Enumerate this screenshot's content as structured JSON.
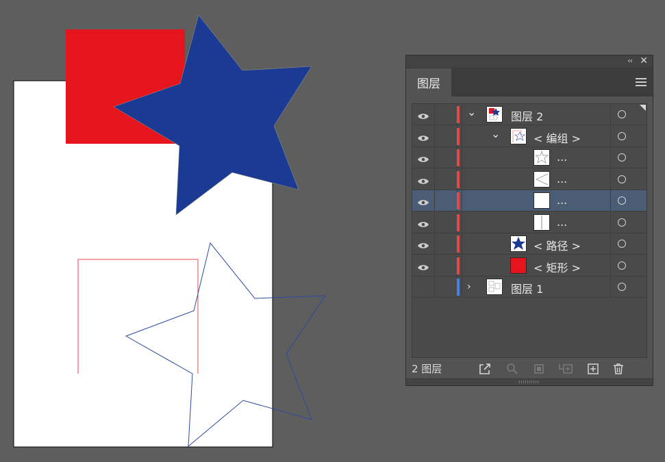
{
  "colors": {
    "canvas_bg": "#5e5e5e",
    "artboard": "#ffffff",
    "red_rect": "#e6141c",
    "blue_star": "#1a3a93",
    "layer2_color": "#e04a4a",
    "layer1_color": "#4a7fe8",
    "selected_row": "#4b5d75"
  },
  "panel": {
    "collapse_icon": "‹‹",
    "close_icon": "✕",
    "tab_label": "图层",
    "menu_icon": "hamburger-menu-icon"
  },
  "layers": [
    {
      "label": "图层 2",
      "indent": 0,
      "chevron": "⌄",
      "thumb": "layer2-thumb",
      "visible": true,
      "color": "#e04a4a",
      "selected": false
    },
    {
      "label": "< 编组 >",
      "indent": 1,
      "chevron": "⌄",
      "thumb": "group-thumb",
      "visible": true,
      "color": "#e04a4a",
      "selected": false
    },
    {
      "label": "...",
      "indent": 2,
      "chevron": "",
      "thumb": "star-outline-thumb",
      "visible": true,
      "color": "#e04a4a",
      "selected": false
    },
    {
      "label": "...",
      "indent": 2,
      "chevron": "",
      "thumb": "triangle-outline-thumb",
      "visible": true,
      "color": "#e04a4a",
      "selected": false
    },
    {
      "label": "...",
      "indent": 2,
      "chevron": "",
      "thumb": "blank-thumb",
      "visible": true,
      "color": "#e04a4a",
      "selected": true
    },
    {
      "label": "...",
      "indent": 2,
      "chevron": "",
      "thumb": "line-thumb",
      "visible": true,
      "color": "#e04a4a",
      "selected": false
    },
    {
      "label": "< 路径 >",
      "indent": 1,
      "chevron": "",
      "thumb": "blue-star-thumb",
      "visible": true,
      "color": "#e04a4a",
      "selected": false
    },
    {
      "label": "< 矩形 >",
      "indent": 1,
      "chevron": "",
      "thumb": "red-rect-thumb",
      "visible": true,
      "color": "#e04a4a",
      "selected": false
    },
    {
      "label": "图层 1",
      "indent": 0,
      "chevron": "›",
      "thumb": "layer1-thumb",
      "visible": false,
      "color": "#4a7fe8",
      "selected": false
    }
  ],
  "footer": {
    "count_label": "2 图层",
    "icons": [
      "export-icon",
      "search-icon",
      "clipping-mask-icon",
      "new-sublayer-icon",
      "new-layer-icon",
      "trash-icon"
    ]
  }
}
